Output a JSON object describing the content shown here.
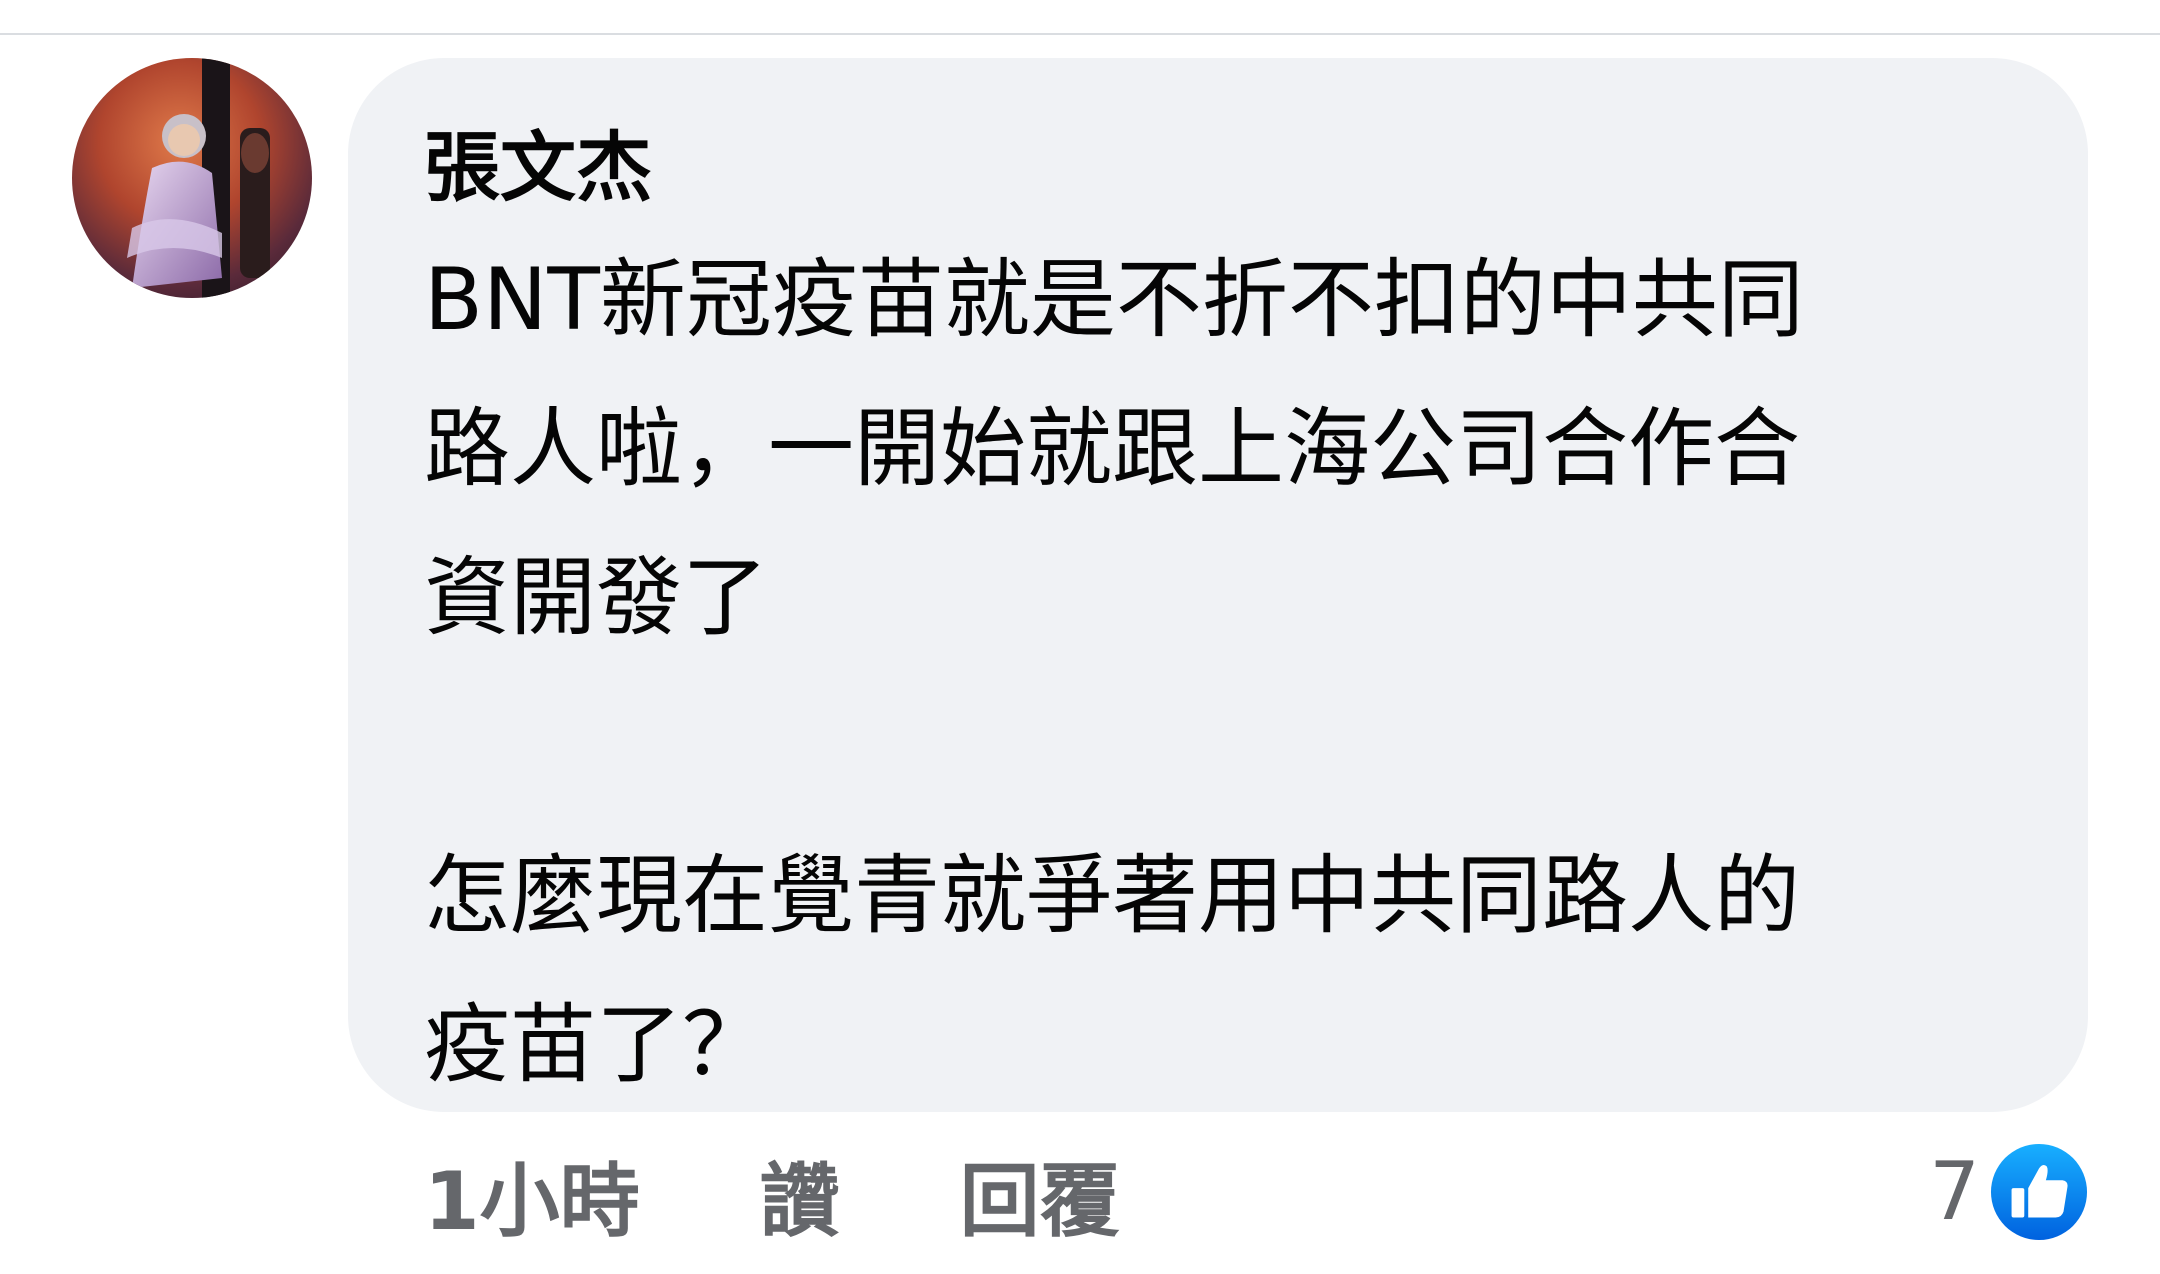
{
  "comment": {
    "author": "張文杰",
    "text": "BNT新冠疫苗就是不折不扣的中共同\n路人啦，一開始就跟上海公司合作合\n資開發了\n\n怎麼現在覺青就爭著用中共同路人的\n疫苗了？",
    "timestamp": "1小時",
    "like_label": "讚",
    "reply_label": "回覆",
    "reaction_count": "7"
  },
  "icons": {
    "reaction": "like-thumb-icon",
    "avatar": "profile-avatar"
  },
  "colors": {
    "bubble_bg": "#f0f2f5",
    "secondary_text": "#65676b",
    "like_blue": "#1877f2"
  }
}
